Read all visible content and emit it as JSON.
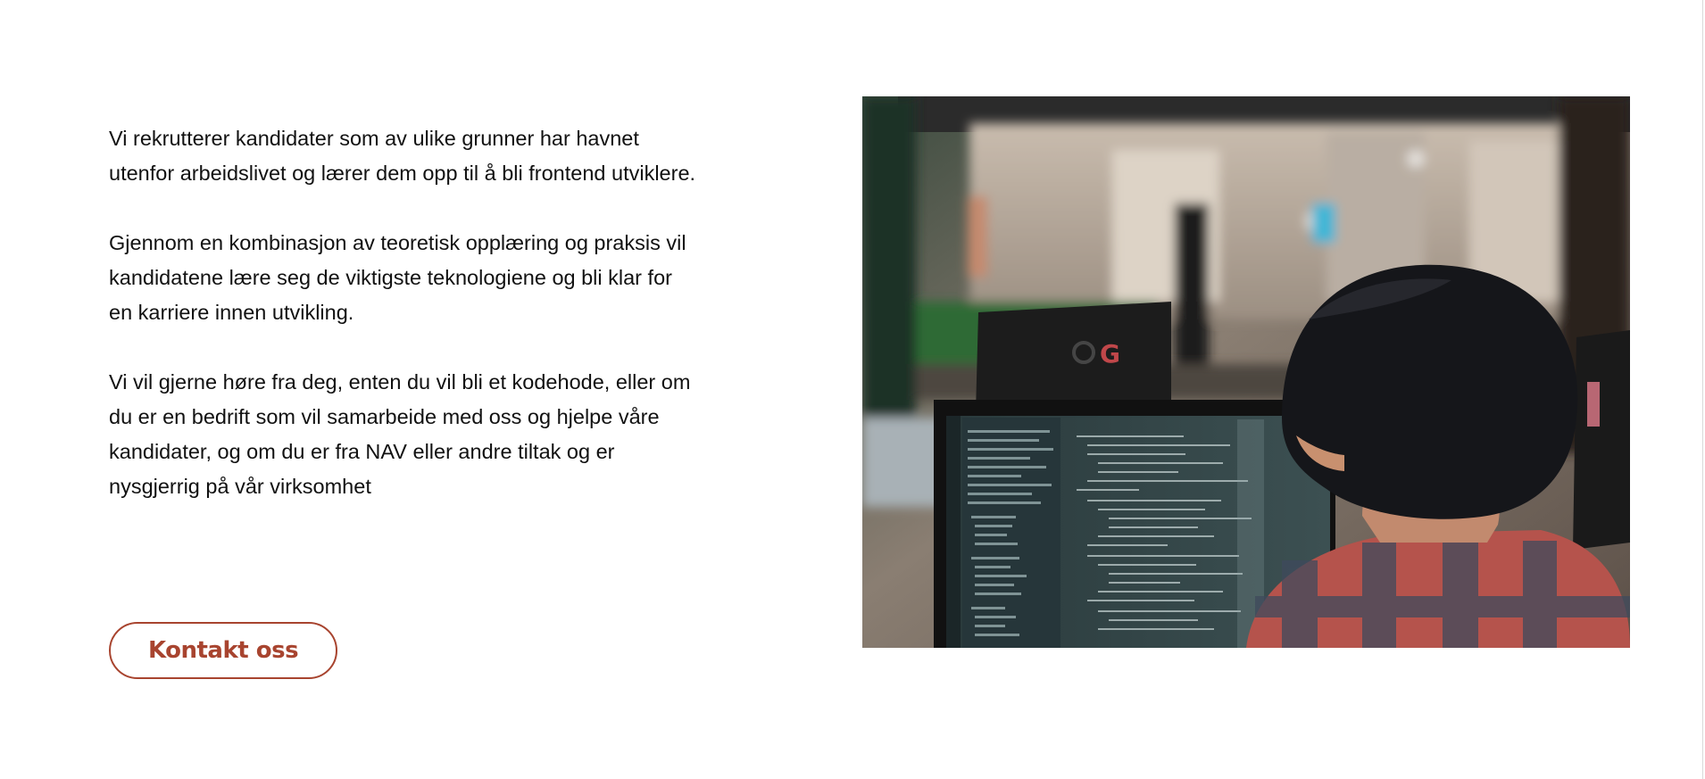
{
  "intro": {
    "paragraphs": [
      "Vi rekrutterer kandidater som av ulike grunner har havnet utenfor arbeidslivet og lærer dem opp til å bli frontend utviklere.",
      "Gjennom en kombinasjon av teoretisk opplæring og praksis vil kandidatene lære seg de viktigste teknologiene og bli klar for en karriere innen utvikling.",
      "Vi vil gjerne høre fra deg, enten du vil bli et kodehode, eller om du er en bedrift som vil samarbeide med oss og hjelpe våre kandidater, og om du er fra NAV eller andre tiltak og er nysgjerrig på vår virksomhet"
    ]
  },
  "cta": {
    "contact_label": "Kontakt oss"
  },
  "photo": {
    "monitor_logo_letter": "G"
  },
  "colors": {
    "accent": "#a8442f",
    "text": "#111111",
    "background": "#ffffff"
  }
}
